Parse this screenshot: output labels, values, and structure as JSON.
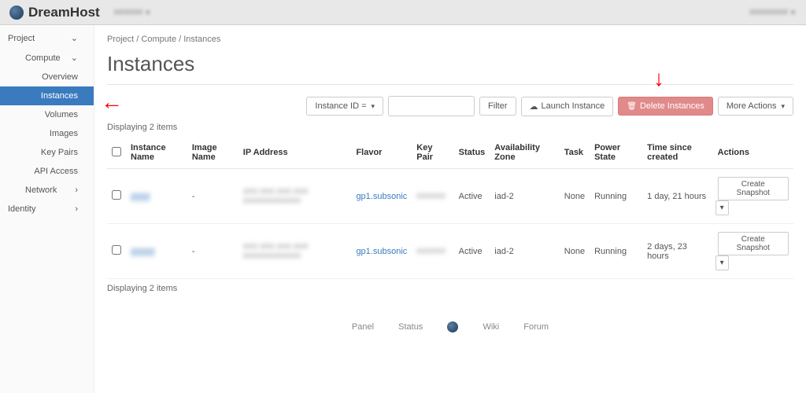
{
  "brand": "DreamHost",
  "top_dropdown": "######",
  "top_right": "########",
  "sidebar": {
    "project": "Project",
    "compute": "Compute",
    "items": {
      "overview": "Overview",
      "instances": "Instances",
      "volumes": "Volumes",
      "images": "Images",
      "keypairs": "Key Pairs",
      "apiaccess": "API Access"
    },
    "network": "Network",
    "identity": "Identity"
  },
  "breadcrumb": {
    "project": "Project",
    "compute": "Compute",
    "instances": "Instances"
  },
  "title": "Instances",
  "toolbar": {
    "filter_by": "Instance ID = ",
    "filter": "Filter",
    "launch": "Launch Instance",
    "delete": "Delete Instances",
    "more": "More Actions"
  },
  "count_top": "Displaying 2 items",
  "count_bottom": "Displaying 2 items",
  "columns": {
    "name": "Instance Name",
    "image": "Image Name",
    "ip": "IP Address",
    "flavor": "Flavor",
    "keypair": "Key Pair",
    "status": "Status",
    "az": "Availability Zone",
    "task": "Task",
    "power": "Power State",
    "time": "Time since created",
    "actions": "Actions"
  },
  "rows": [
    {
      "name_blur": "####",
      "image": "-",
      "ip_blur": "###.###.###.### ############",
      "flavor": "gp1.subsonic",
      "keypair_blur": "######",
      "status": "Active",
      "az": "iad-2",
      "task": "None",
      "power": "Running",
      "time": "1 day, 21 hours",
      "action": "Create Snapshot"
    },
    {
      "name_blur": "#####",
      "image": "-",
      "ip_blur": "###.###.###.### ############",
      "flavor": "gp1.subsonic",
      "keypair_blur": "######",
      "status": "Active",
      "az": "iad-2",
      "task": "None",
      "power": "Running",
      "time": "2 days, 23 hours",
      "action": "Create Snapshot"
    }
  ],
  "footer": {
    "panel": "Panel",
    "status": "Status",
    "wiki": "Wiki",
    "forum": "Forum"
  }
}
